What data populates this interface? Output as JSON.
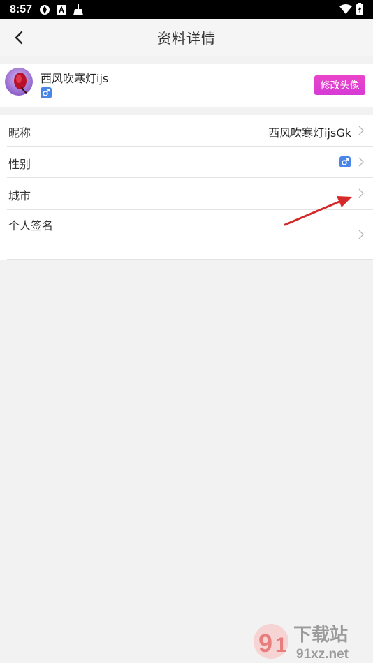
{
  "status_bar": {
    "time": "8:57"
  },
  "nav": {
    "title": "资料详情"
  },
  "profile": {
    "name": "西风吹寒灯ijs",
    "change_avatar_label": "修改头像"
  },
  "rows": {
    "nickname": {
      "label": "昵称",
      "value": "西风吹寒灯ijsGk"
    },
    "gender": {
      "label": "性别"
    },
    "city": {
      "label": "城市"
    },
    "signature": {
      "label": "个人签名"
    }
  },
  "watermark": {
    "brand": "下载站",
    "domain": "91xz.net"
  },
  "colors": {
    "accent": "#e443c9",
    "gender_badge": "#4a86e8",
    "annotation_arrow": "#d42a2a"
  }
}
